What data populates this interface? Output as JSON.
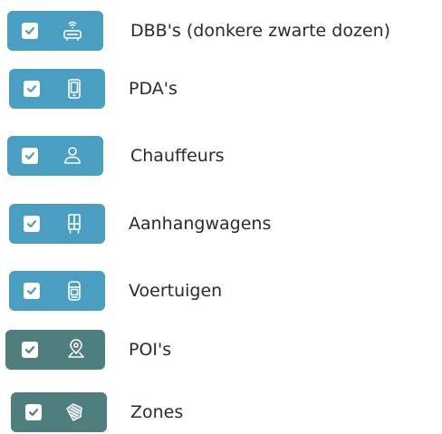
{
  "layers": [
    {
      "label": "DBB's (donkere zwarte dozen)",
      "icon": "router-icon",
      "checked": true,
      "color": "#4a9ec2"
    },
    {
      "label": "PDA's",
      "icon": "tablet-icon",
      "checked": true,
      "color": "#4a9ec2"
    },
    {
      "label": "Chauffeurs",
      "icon": "person-icon",
      "checked": true,
      "color": "#4a9ec2"
    },
    {
      "label": "Aanhangwagens",
      "icon": "trailer-icon",
      "checked": true,
      "color": "#4a9ec2"
    },
    {
      "label": "Voertuigen",
      "icon": "vehicle-icon",
      "checked": true,
      "color": "#4a9ec2"
    },
    {
      "label": "POI's",
      "icon": "map-pin-icon",
      "checked": true,
      "color": "#4e7f7e"
    },
    {
      "label": "Zones",
      "icon": "zone-icon",
      "checked": true,
      "color": "#4e7f7e"
    }
  ]
}
